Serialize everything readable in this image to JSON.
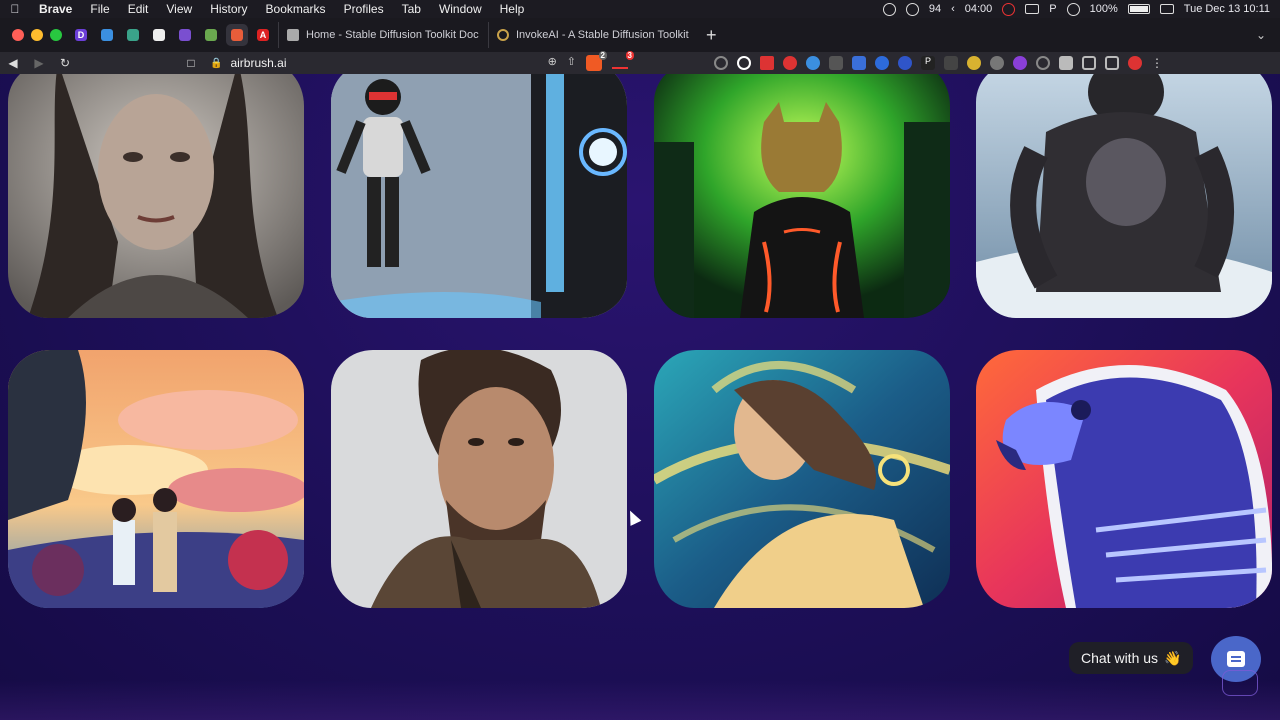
{
  "menubar": {
    "items": [
      "Brave",
      "File",
      "Edit",
      "View",
      "History",
      "Bookmarks",
      "Profiles",
      "Tab",
      "Window",
      "Help"
    ],
    "badge_count": "94",
    "timer": "04:00",
    "battery": "100%",
    "clock": "Tue Dec 13  10:11"
  },
  "tabs": [
    {
      "title": "Home - Stable Diffusion Toolkit Doc"
    },
    {
      "title": "InvokeAI - A Stable Diffusion Toolkit"
    }
  ],
  "pinned_tabs": [
    {
      "icon": "d-icon",
      "label": "D",
      "color": "#6b3fd8"
    },
    {
      "icon": "gem-icon",
      "color": "#3b8fe0"
    },
    {
      "icon": "chatgpt-icon",
      "color": "#3aa38a"
    },
    {
      "icon": "github-icon",
      "color": "#eeeeee"
    },
    {
      "icon": "ext-icon",
      "color": "#7a4fd0"
    },
    {
      "icon": "image-icon",
      "color": "#6aa84f"
    },
    {
      "icon": "airbrush-icon",
      "color": "#e85d3a"
    },
    {
      "icon": "angular-icon",
      "label": "A",
      "color": "#dd2222"
    }
  ],
  "toolbar": {
    "url": "airbrush.ai",
    "shields_badge": "2",
    "rewards_badge": "3"
  },
  "gallery": {
    "images": [
      {
        "name": "woman-portrait"
      },
      {
        "name": "astronaut-figure"
      },
      {
        "name": "neon-cheetah"
      },
      {
        "name": "gorilla"
      },
      {
        "name": "anime-couple-sunset"
      },
      {
        "name": "man-portrait"
      },
      {
        "name": "glowing-woman"
      },
      {
        "name": "eagle-illustration"
      }
    ]
  },
  "chat": {
    "label": "Chat with us",
    "emoji": "👋"
  },
  "colors": {
    "page_bg": "#1d0f58",
    "chat_button": "#4a67c9"
  }
}
